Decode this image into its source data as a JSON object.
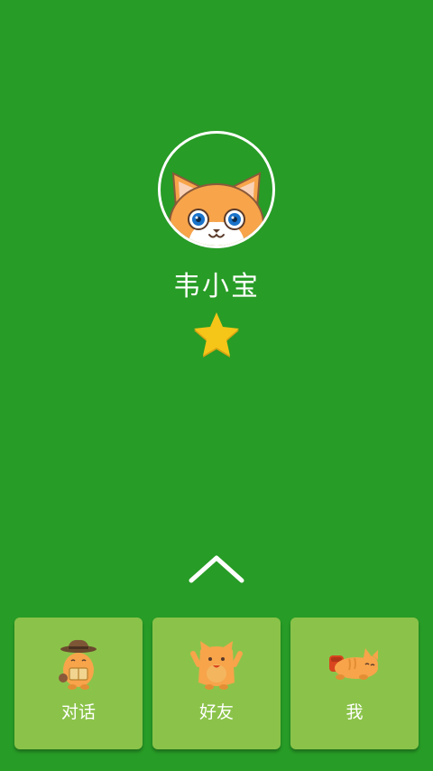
{
  "profile": {
    "avatar_icon": "orange-cat-avatar-icon",
    "name": "韦小宝",
    "level_icon": "gold-star-icon",
    "level_stars": 1
  },
  "expand": {
    "icon": "chevron-up-icon"
  },
  "tabs": [
    {
      "label": "对话",
      "icon": "cat-explorer-icon"
    },
    {
      "label": "好友",
      "icon": "cat-waving-icon"
    },
    {
      "label": "我",
      "icon": "cat-lying-icon"
    }
  ],
  "colors": {
    "background": "#279c26",
    "tab_background": "#8bc34a",
    "text": "#ffffff",
    "star": "#f5c518",
    "cat_orange": "#f7a44a"
  }
}
